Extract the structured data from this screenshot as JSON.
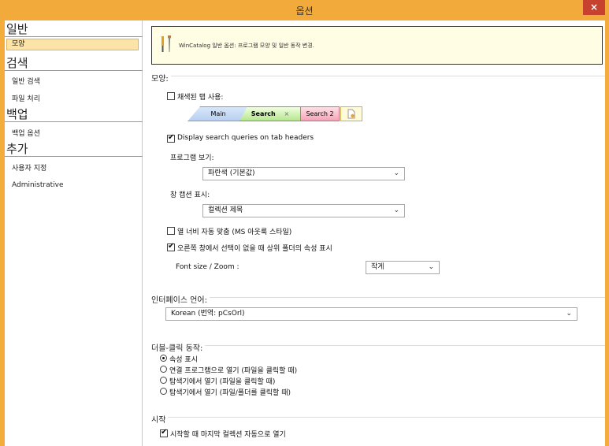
{
  "window": {
    "title": "옵션",
    "close_glyph": "×"
  },
  "sidebar": {
    "sections": [
      {
        "heading": "일반",
        "items": [
          "모양"
        ]
      },
      {
        "heading": "검색",
        "items": [
          "일반 검색",
          "파일 처리"
        ]
      },
      {
        "heading": "백업",
        "items": [
          "백업 옵션"
        ]
      },
      {
        "heading": "추가",
        "items": [
          "사용자 지정",
          "Administrative"
        ]
      }
    ],
    "selected_item": "모양"
  },
  "info": {
    "text": "WinCatalog 일반 옵션: 프로그램 모양 및 일반 동작 변경."
  },
  "appearance": {
    "legend": "모양:",
    "colored_tabs": {
      "label": "채색된 탭 사용:",
      "checked": false
    },
    "tabs_preview": {
      "main": "Main",
      "search": "Search",
      "search_close": "×",
      "search2": "Search 2"
    },
    "display_queries": {
      "label": "Display search queries on tab headers",
      "checked": true
    },
    "program_view_label": "프로그램 보기:",
    "program_view_value": "파란색 (기본값)",
    "window_caption_label": "창 캡션 표시:",
    "window_caption_value": "컬렉션 제목",
    "auto_column_width": {
      "label": "열 너비 자동 맞춤 (MS 아웃룩 스타일)",
      "checked": false
    },
    "show_parent_props": {
      "label": "오른쪽 창에서 선택이 없을 때 상위 폴더의 속성 표시",
      "checked": true
    },
    "font_size_label": "Font size / Zoom :",
    "font_size_value": "작게"
  },
  "language": {
    "legend": "인터페이스 언어:",
    "value": "Korean (번역: pCsOrl)"
  },
  "double_click": {
    "legend": "더블-클릭 동작:",
    "options": [
      {
        "label": "속성 표시",
        "checked": true
      },
      {
        "label": "연결 프로그램으로 열기 (파일을 클릭할 때)",
        "checked": false
      },
      {
        "label": "탐색기에서 열기 (파일을 클릭할 때)",
        "checked": false
      },
      {
        "label": "탐색기에서 열기 (파일/폴더를 클릭할 때)",
        "checked": false
      }
    ]
  },
  "startup": {
    "legend": "시작",
    "open_last": {
      "label": "시작할 때 마지막 컬렉션 자동으로 열기",
      "checked": true
    }
  },
  "chevron": "⌄"
}
